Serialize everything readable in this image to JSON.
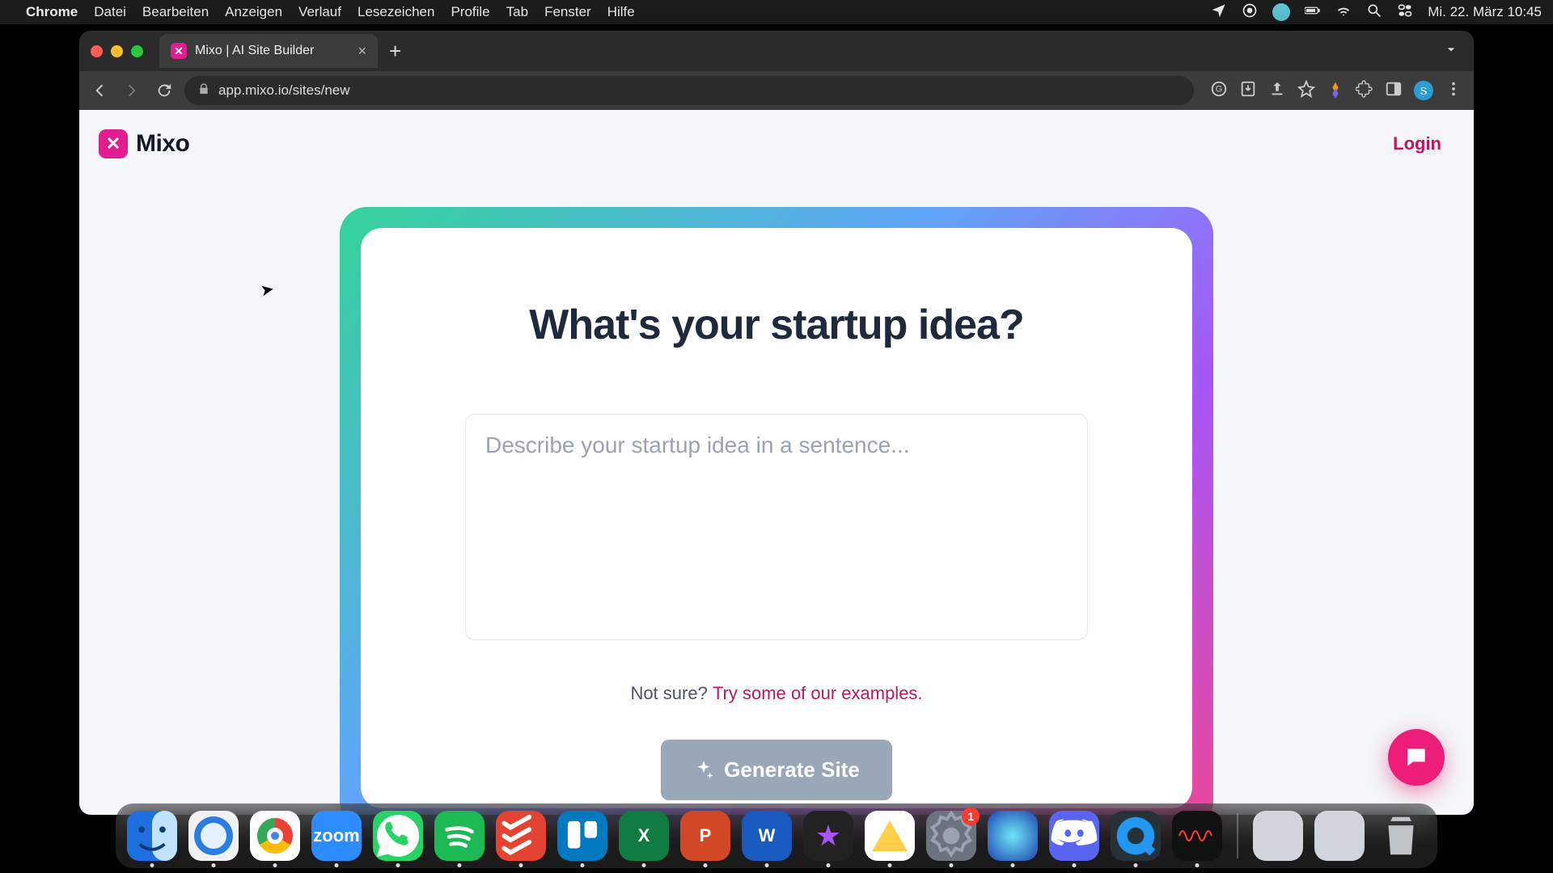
{
  "menubar": {
    "app": "Chrome",
    "items": [
      "Datei",
      "Bearbeiten",
      "Anzeigen",
      "Verlauf",
      "Lesezeichen",
      "Profile",
      "Tab",
      "Fenster",
      "Hilfe"
    ],
    "clock": "Mi. 22. März  10:45"
  },
  "browser": {
    "tab_title": "Mixo | AI Site Builder",
    "url": "app.mixo.io/sites/new",
    "profile_initial": "S"
  },
  "page": {
    "brand": "Mixo",
    "login": "Login",
    "heading": "What's your startup idea?",
    "placeholder": "Describe your startup idea in a sentence...",
    "hint_prefix": "Not sure? ",
    "hint_link": "Try some of our examples.",
    "generate": "Generate Site"
  },
  "dock": {
    "apps": [
      {
        "name": "finder",
        "label": "Finder",
        "running": true
      },
      {
        "name": "safari",
        "label": "Safari",
        "running": true
      },
      {
        "name": "chrome",
        "label": "Chrome",
        "running": true
      },
      {
        "name": "zoom",
        "label": "Zoom",
        "glyph": "zoom",
        "running": true
      },
      {
        "name": "whatsapp",
        "label": "WhatsApp",
        "running": true
      },
      {
        "name": "spotify",
        "label": "Spotify",
        "running": true
      },
      {
        "name": "todoist",
        "label": "Todoist",
        "running": true
      },
      {
        "name": "trello",
        "label": "Trello",
        "running": true
      },
      {
        "name": "excel",
        "label": "Excel",
        "glyph": "X",
        "running": true
      },
      {
        "name": "powerpoint",
        "label": "PowerPoint",
        "glyph": "P",
        "running": true
      },
      {
        "name": "word",
        "label": "Word",
        "glyph": "W",
        "running": true
      },
      {
        "name": "imovie",
        "label": "iMovie",
        "glyph": "★",
        "running": true
      },
      {
        "name": "gdrive",
        "label": "Google Drive",
        "running": true
      },
      {
        "name": "settings",
        "label": "System Settings",
        "badge": "1",
        "running": true
      },
      {
        "name": "app-teal",
        "label": "App",
        "running": true
      },
      {
        "name": "discord",
        "label": "Discord",
        "running": true
      },
      {
        "name": "quicktime",
        "label": "QuickTime",
        "running": true
      },
      {
        "name": "voicememos",
        "label": "Voice Memos",
        "running": true
      }
    ],
    "right": [
      {
        "name": "app-generic-1",
        "label": "App"
      },
      {
        "name": "app-generic-2",
        "label": "App"
      },
      {
        "name": "trash",
        "label": "Trash"
      }
    ]
  }
}
